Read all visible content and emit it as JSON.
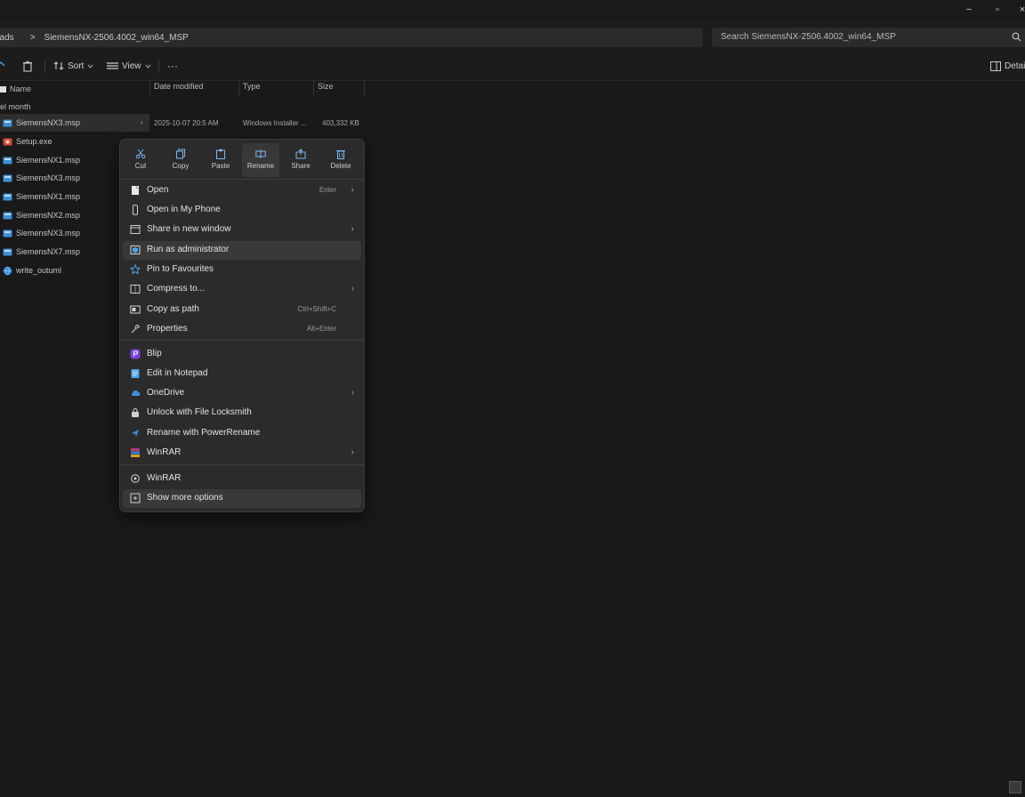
{
  "window": {
    "controls": [
      "−",
      "▫",
      "×"
    ]
  },
  "address": {
    "breadcrumb_root": "oads",
    "chevron": ">",
    "current_folder": "SiemensNX-2506.4002_win64_MSP",
    "search_placeholder": "Search SiemensNX-2506.4002_win64_MSP"
  },
  "toolbar": {
    "sort_label": "Sort",
    "view_label": "View",
    "more_label": "···",
    "details_label": "Details"
  },
  "columns": {
    "name": "Name",
    "date_modified": "Date modified",
    "type": "Type",
    "size": "Size"
  },
  "list": {
    "group_label": "el month",
    "first_row": {
      "date": "2025-10-07 20:5 AM",
      "type": "Windows Installer ...",
      "size": "403,332 KB"
    },
    "files": [
      {
        "name": "SiemensNX3.msp",
        "icon": "installer-icon"
      },
      {
        "name": "Setup.exe",
        "icon": "setup-icon"
      },
      {
        "name": "SiemensNX1.msp",
        "icon": "installer-icon"
      },
      {
        "name": "SiemensNX3.msp",
        "icon": "installer-icon"
      },
      {
        "name": "SiemensNX1.msp",
        "icon": "installer-icon"
      },
      {
        "name": "SiemensNX2.msp",
        "icon": "installer-icon"
      },
      {
        "name": "SiemensNX3.msp",
        "icon": "installer-icon"
      },
      {
        "name": "SiemensNX7.msp",
        "icon": "installer-icon"
      },
      {
        "name": "write_outuml",
        "icon": "globe-icon"
      }
    ]
  },
  "context_menu": {
    "quick_actions": [
      {
        "label": "Cut",
        "icon": "scissors-icon"
      },
      {
        "label": "Copy",
        "icon": "copy-icon"
      },
      {
        "label": "Paste",
        "icon": "paste-icon"
      },
      {
        "label": "Rename",
        "icon": "rename-icon"
      },
      {
        "label": "Share",
        "icon": "share-icon"
      },
      {
        "label": "Delete",
        "icon": "trash-icon"
      }
    ],
    "items": [
      {
        "label": "Open",
        "shortcut": "Enter",
        "submenu": true,
        "icon": "open-icon"
      },
      {
        "label": "Open in My Phone",
        "shortcut": "",
        "submenu": false,
        "icon": "phone-icon"
      },
      {
        "label": "Share in new window",
        "shortcut": "",
        "submenu": true,
        "icon": "window-icon"
      },
      {
        "label": "Run as administrator",
        "shortcut": "",
        "submenu": false,
        "icon": "shield-icon",
        "hover": true
      },
      {
        "label": "Pin to Favourites",
        "shortcut": "",
        "submenu": false,
        "icon": "star-icon"
      },
      {
        "label": "Compress to...",
        "shortcut": "",
        "submenu": true,
        "icon": "compress-icon"
      },
      {
        "label": "Copy as path",
        "shortcut": "Ctrl+Shift+C",
        "submenu": false,
        "icon": "path-icon"
      },
      {
        "label": "Properties",
        "shortcut": "Alt+Enter",
        "submenu": false,
        "icon": "wrench-icon"
      },
      {
        "label": "Blip",
        "shortcut": "",
        "submenu": false,
        "icon": "blip-icon"
      },
      {
        "label": "Edit in Notepad",
        "shortcut": "",
        "submenu": false,
        "icon": "notepad-icon"
      },
      {
        "label": "OneDrive",
        "shortcut": "",
        "submenu": true,
        "icon": "cloud-icon"
      },
      {
        "label": "Unlock with File Locksmith",
        "shortcut": "",
        "submenu": false,
        "icon": "lock-icon"
      },
      {
        "label": "Rename with PowerRename",
        "shortcut": "",
        "submenu": false,
        "icon": "power-rename-icon"
      },
      {
        "label": "WinRAR",
        "shortcut": "",
        "submenu": true,
        "icon": "winrar-icon"
      },
      {
        "label": "WinRAR",
        "shortcut": "",
        "submenu": false,
        "icon": "winrar-settings-icon"
      },
      {
        "label": "Show more options",
        "shortcut": "",
        "submenu": false,
        "icon": "more-options-icon",
        "hover": true
      }
    ]
  },
  "colors": {
    "background": "#191919",
    "menu_bg": "#2b2b2b",
    "accent": "#4ea3e6"
  }
}
